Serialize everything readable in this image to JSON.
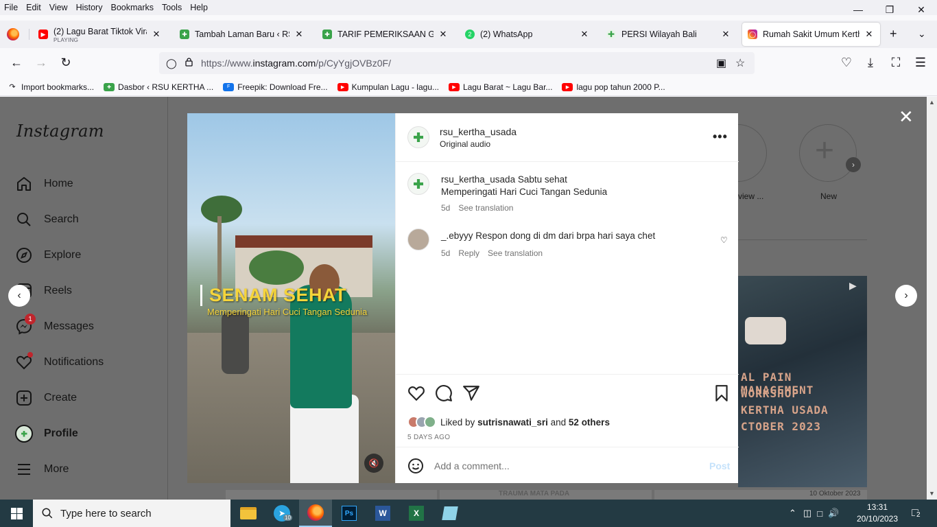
{
  "menubar": [
    "File",
    "Edit",
    "View",
    "History",
    "Bookmarks",
    "Tools",
    "Help"
  ],
  "tabs": [
    {
      "label": "(2) Lagu Barat Tiktok Viral 2023",
      "sub": "PLAYING",
      "icon": "youtube-icon",
      "color": "#ff0000"
    },
    {
      "label": "Tambah Laman Baru ‹ RSU Kertha",
      "icon": "rsu-icon",
      "color": "#3aa34a"
    },
    {
      "label": "TARIF PEMERIKSAAN GENOMIK",
      "icon": "rsu-icon",
      "color": "#3aa34a"
    },
    {
      "label": "(2) WhatsApp",
      "icon": "whatsapp-icon",
      "color": "#25d366"
    },
    {
      "label": "PERSI Wilayah Bali",
      "icon": "persi-icon",
      "color": "#3aa34a"
    },
    {
      "label": "Rumah Sakit Umum Kertha Usada",
      "icon": "instagram-icon",
      "color": "#d62976"
    }
  ],
  "address": {
    "prefix": "https://www.",
    "domain": "instagram.com",
    "path": "/p/CyYgjOVBz0F/"
  },
  "bookmarks": [
    {
      "label": "Import bookmarks...",
      "color": "#f9f9fb"
    },
    {
      "label": "Dasbor ‹ RSU KERTHA ...",
      "color": "#3aa34a"
    },
    {
      "label": "Freepik: Download Fre...",
      "color": "#1273eb"
    },
    {
      "label": "Kumpulan Lagu - lagu...",
      "color": "#ff0000"
    },
    {
      "label": "Lagu Barat ~ Lagu Bar...",
      "color": "#ff0000"
    },
    {
      "label": "lagu pop tahun 2000 P...",
      "color": "#ff0000"
    }
  ],
  "instagram": {
    "logo": "Instagram",
    "nav": [
      {
        "label": "Home",
        "icon": "home-icon"
      },
      {
        "label": "Search",
        "icon": "search-icon"
      },
      {
        "label": "Explore",
        "icon": "compass-icon"
      },
      {
        "label": "Reels",
        "icon": "reels-icon"
      },
      {
        "label": "Messages",
        "icon": "messenger-icon",
        "badge": "1"
      },
      {
        "label": "Notifications",
        "icon": "heart-icon"
      },
      {
        "label": "Create",
        "icon": "plus-square-icon"
      },
      {
        "label": "Profile",
        "icon": "profile-avatar"
      },
      {
        "label": "More",
        "icon": "menu-icon"
      }
    ],
    "highlights": {
      "review": "view ...",
      "new": "New"
    },
    "bg_thumb_lines": [
      "AL PAIN MANAGEMENT",
      "WORKSHOP",
      "KERTHA USADA",
      "CTOBER 2023"
    ],
    "bg_strip_texts": [
      "TRAUMA MATA PADA",
      "10 Oktober 2023"
    ]
  },
  "post": {
    "media": {
      "title": "SENAM SEHAT",
      "subtitle": "Memperingati  Hari Cuci Tangan Sedunia"
    },
    "author": "rsu_kertha_usada",
    "audio": "Original audio",
    "caption": {
      "user": "rsu_kertha_usada",
      "line1": "Sabtu sehat",
      "line2": "Memperingati Hari Cuci Tangan Sedunia",
      "time": "5d",
      "translate": "See translation"
    },
    "comment": {
      "user": "_.ebyyy",
      "text": "Respon dong di dm dari brpa hari saya chet",
      "time": "5d",
      "reply": "Reply",
      "translate": "See translation"
    },
    "likes": {
      "prefix": "Liked by",
      "user": "sutrisnawati_sri",
      "and": "and",
      "others": "52 others"
    },
    "ago": "5 DAYS AGO",
    "add_comment_placeholder": "Add a comment...",
    "post_button": "Post"
  },
  "taskbar": {
    "search_placeholder": "Type here to search",
    "time": "13:31",
    "date": "20/10/2023",
    "notif_count": "2",
    "telegram_badge": "10"
  }
}
